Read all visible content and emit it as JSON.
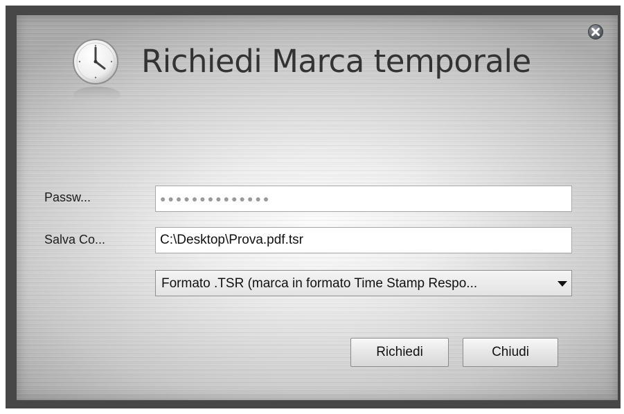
{
  "dialog": {
    "title": "Richiedi Marca temporale",
    "close_icon": "close-circle-icon",
    "clock_icon": "clock-icon"
  },
  "form": {
    "password_label": "Passw...",
    "password_value": "●●●●●●●●●●●●●●",
    "save_label": "Salva Co...",
    "save_value": "C:\\Desktop\\Prova.pdf.tsr",
    "format_selected": "Formato .TSR (marca in formato Time Stamp Respo..."
  },
  "buttons": {
    "request_label": "Richiedi",
    "close_label": "Chiudi"
  }
}
